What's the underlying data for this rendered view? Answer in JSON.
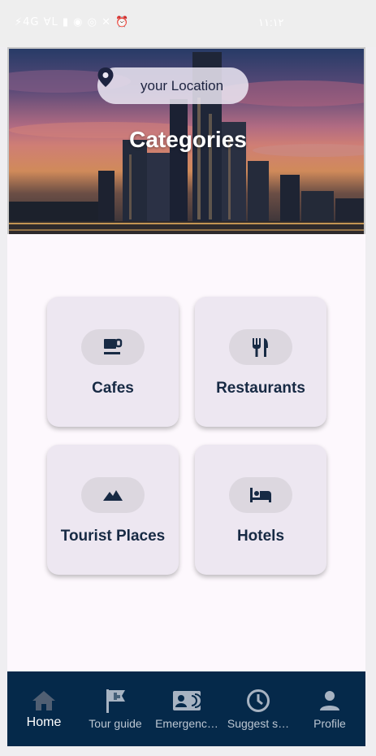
{
  "status_bar": {
    "left": "⚡4G ∀L ▮ ◉ ◎ ✕ ⏰",
    "time": "١١:١٢"
  },
  "header": {
    "location_pill": {
      "label": "your Location",
      "icon": "location-pin-icon"
    },
    "title": "Categories"
  },
  "categories": [
    {
      "label": "Cafes",
      "icon": "coffee-cup-icon"
    },
    {
      "label": "Restaurants",
      "icon": "fork-knife-icon"
    },
    {
      "label": "Tourist Places",
      "icon": "mountains-icon"
    },
    {
      "label": "Hotels",
      "icon": "bed-icon"
    }
  ],
  "bottom_nav": {
    "items": [
      {
        "label": "Home",
        "icon": "home-icon",
        "active": true
      },
      {
        "label": "Tour guide",
        "icon": "flag-icon",
        "active": false
      },
      {
        "label": "Emergenc…",
        "icon": "contact-card-icon",
        "active": false
      },
      {
        "label": "Suggest s…",
        "icon": "clock-icon",
        "active": false
      },
      {
        "label": "Profile",
        "icon": "person-icon",
        "active": false
      }
    ]
  },
  "colors": {
    "nav_background": "#05294a",
    "card_background": "#ede7f1",
    "icon_pill": "#dcd7df",
    "label_text": "#172a44"
  }
}
